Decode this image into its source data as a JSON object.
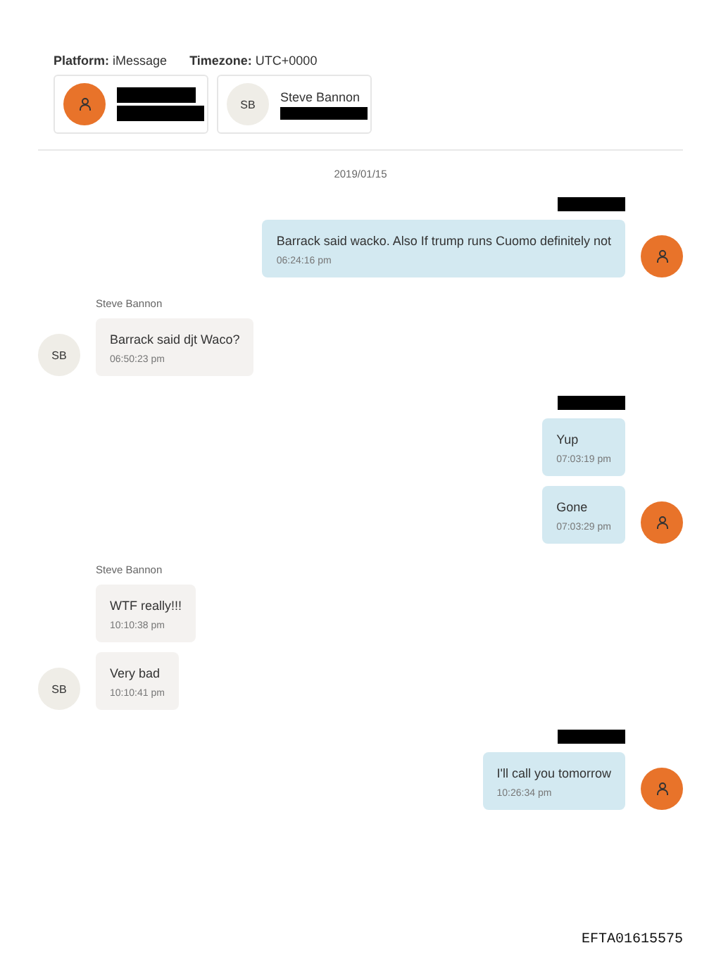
{
  "header": {
    "platform_label": "Platform:",
    "platform": "iMessage",
    "timezone_label": "Timezone:",
    "timezone": "UTC+0000"
  },
  "participants": [
    {
      "kind": "owner"
    },
    {
      "kind": "contact",
      "initials": "SB",
      "name": "Steve Bannon"
    }
  ],
  "date": "2019/01/15",
  "groups": [
    {
      "kind": "outgoing",
      "messages": [
        {
          "text": "Barrack said wacko. Also If trump runs Cuomo definitely not",
          "time": "06:24:16 pm"
        }
      ]
    },
    {
      "kind": "incoming",
      "sender": "Steve Bannon",
      "initials": "SB",
      "messages": [
        {
          "text": "Barrack said djt Waco?",
          "time": "06:50:23 pm"
        }
      ]
    },
    {
      "kind": "outgoing",
      "messages": [
        {
          "text": "Yup",
          "time": "07:03:19 pm"
        },
        {
          "text": "Gone",
          "time": "07:03:29 pm"
        }
      ]
    },
    {
      "kind": "incoming",
      "sender": "Steve Bannon",
      "initials": "SB",
      "messages": [
        {
          "text": "WTF really!!!",
          "time": "10:10:38 pm"
        },
        {
          "text": "Very bad",
          "time": "10:10:41 pm"
        }
      ]
    },
    {
      "kind": "outgoing",
      "messages": [
        {
          "text": "I'll call you tomorrow",
          "time": "10:26:34 pm"
        }
      ]
    }
  ],
  "stamp": "EFTA01615575"
}
